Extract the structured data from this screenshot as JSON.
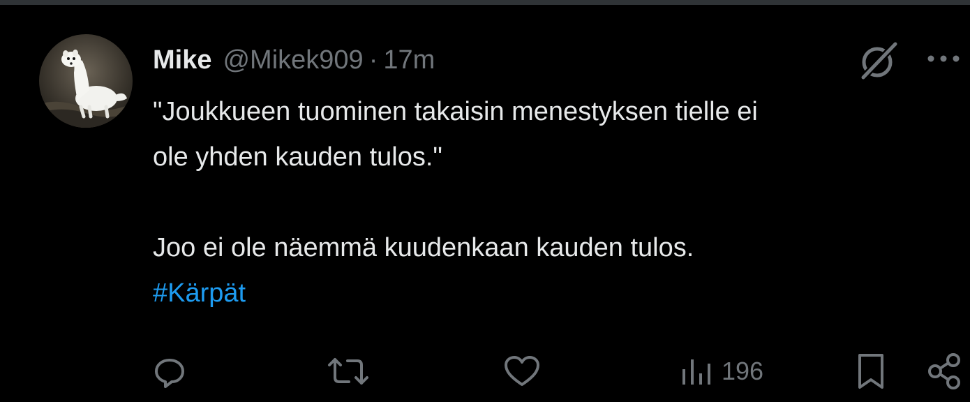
{
  "tweet": {
    "author": {
      "display_name": "Mike",
      "handle": "@Mikek909",
      "avatar": "white-ermine-photo"
    },
    "separator": "·",
    "time": "17m",
    "text": {
      "line1": "\"Joukkueen tuominen takaisin menestyksen tielle ei",
      "line2": "ole yhden kauden tulos.\"",
      "line3": "Joo ei ole näemmä kuudenkaan kauden tulos.",
      "hashtag": "#Kärpät"
    },
    "actions": {
      "reply_icon": "reply-icon",
      "retweet_icon": "retweet-icon",
      "like_icon": "heart-icon",
      "views_icon": "views-bar-chart-icon",
      "views_count": "196",
      "bookmark_icon": "bookmark-icon",
      "share_icon": "share-icon"
    },
    "header_icons": [
      "grok-icon",
      "more-dots-icon"
    ]
  },
  "colors": {
    "background": "#000000",
    "text_primary": "#e7e9ea",
    "text_secondary": "#71767b",
    "accent": "#1d9bf0",
    "divider": "#2f3336"
  }
}
